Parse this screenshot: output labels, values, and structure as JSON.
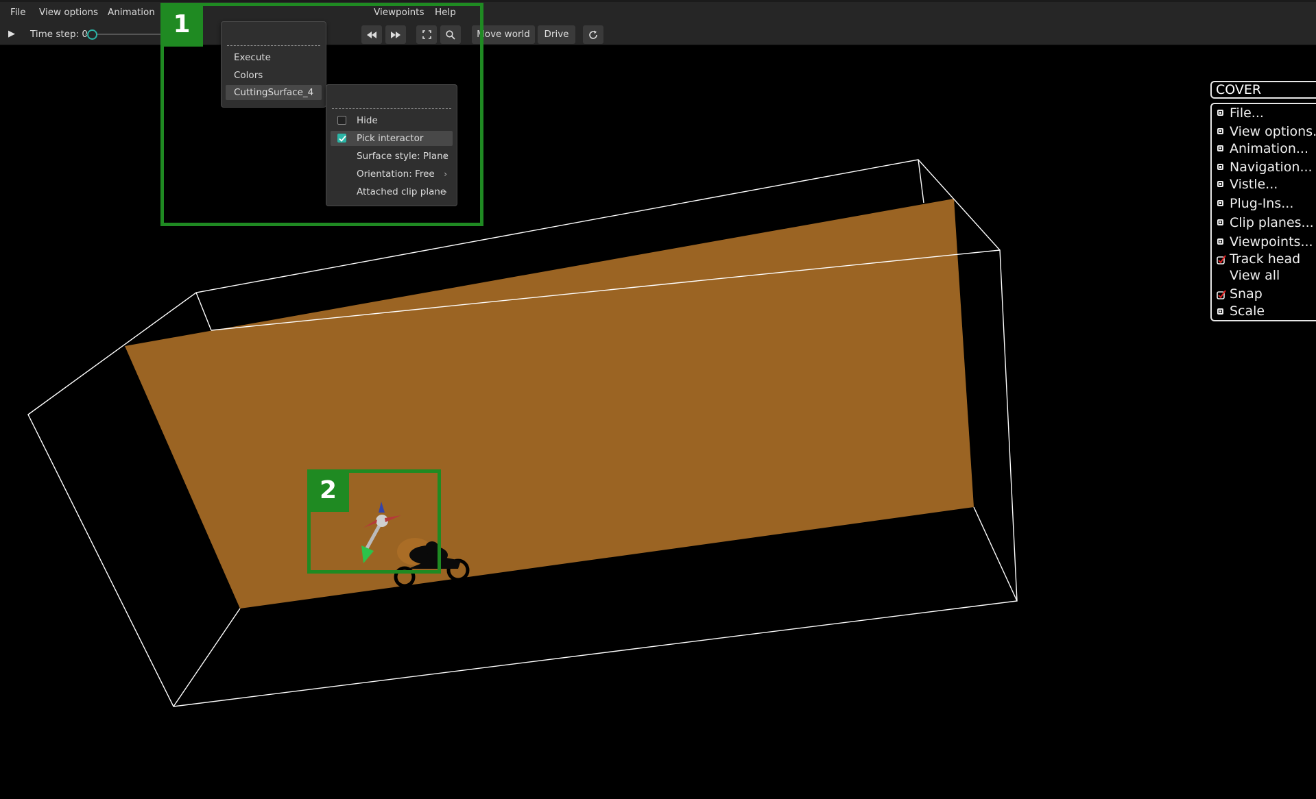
{
  "menubar": {
    "items": [
      "File",
      "View options",
      "Animation",
      "Viewpoints",
      "Help"
    ]
  },
  "toolbar": {
    "play_icon": "play-icon",
    "timestep_label": "Time step: 0",
    "timestep_value": 0,
    "buttons": {
      "rewind": "rewind-icon",
      "forward": "fast-forward-icon",
      "fullscreen": "fullscreen-icon",
      "search": "search-icon",
      "move_world": "Move world",
      "drive": "Drive",
      "reload": "reload-icon"
    }
  },
  "submenu1": {
    "items": [
      "Execute",
      "Colors",
      "CuttingSurface_4"
    ],
    "highlighted": "CuttingSurface_4"
  },
  "submenu2": {
    "hide": {
      "label": "Hide",
      "checked": false
    },
    "pick": {
      "label": "Pick interactor",
      "checked": true
    },
    "surface_style": "Surface style: Plane",
    "orientation": "Orientation: Free",
    "attached_clip": "Attached clip plane"
  },
  "annotations": {
    "label1": "1",
    "label2": "2",
    "color": "#1f8a22"
  },
  "cover": {
    "title": "COVER",
    "items": [
      {
        "label": "File...",
        "kind": "box"
      },
      {
        "label": "View options...",
        "kind": "box"
      },
      {
        "label": "Animation...",
        "kind": "box"
      },
      {
        "label": "Navigation...",
        "kind": "box"
      },
      {
        "label": "Vistle...",
        "kind": "box"
      },
      {
        "label": "Plug-Ins...",
        "kind": "box"
      },
      {
        "label": "Clip planes...",
        "kind": "box"
      },
      {
        "label": "Viewpoints...",
        "kind": "box"
      },
      {
        "label": "Track head",
        "kind": "check"
      },
      {
        "label": "View all",
        "kind": "none"
      },
      {
        "label": "Snap",
        "kind": "check"
      },
      {
        "label": "Scale",
        "kind": "box"
      }
    ]
  },
  "scene": {
    "plane_color": "#9b6423",
    "box_color": "#ffffff"
  }
}
